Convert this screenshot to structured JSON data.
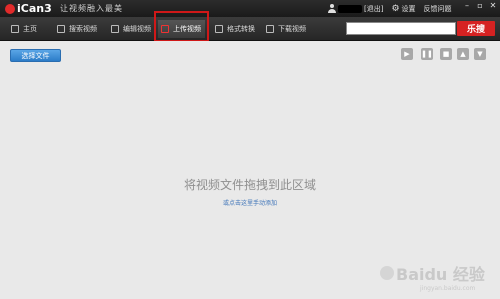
{
  "app": {
    "logo": "iCan3",
    "slogan": "让视频融入最美"
  },
  "header": {
    "logout": "[退出]",
    "settings": "设置",
    "feedback": "反馈问题"
  },
  "tabs": [
    {
      "label": "主页"
    },
    {
      "label": "搜索视频"
    },
    {
      "label": "编辑视频"
    },
    {
      "label": "上传视频",
      "active": true
    },
    {
      "label": "格式转换"
    },
    {
      "label": "下载视频"
    }
  ],
  "search": {
    "value": "",
    "button_label": "乐搜"
  },
  "main": {
    "choose_file_label": "选择文件",
    "drop_title": "将视频文件拖拽到此区域",
    "drop_link": "或点击这里手动添加"
  },
  "watermark": {
    "text": "Baidu 经验",
    "sub": "jingyan.baidu.com"
  },
  "colors": {
    "accent_red": "#d62222",
    "button_blue": "#2c7cc8",
    "toolbar_dark": "#262626"
  }
}
